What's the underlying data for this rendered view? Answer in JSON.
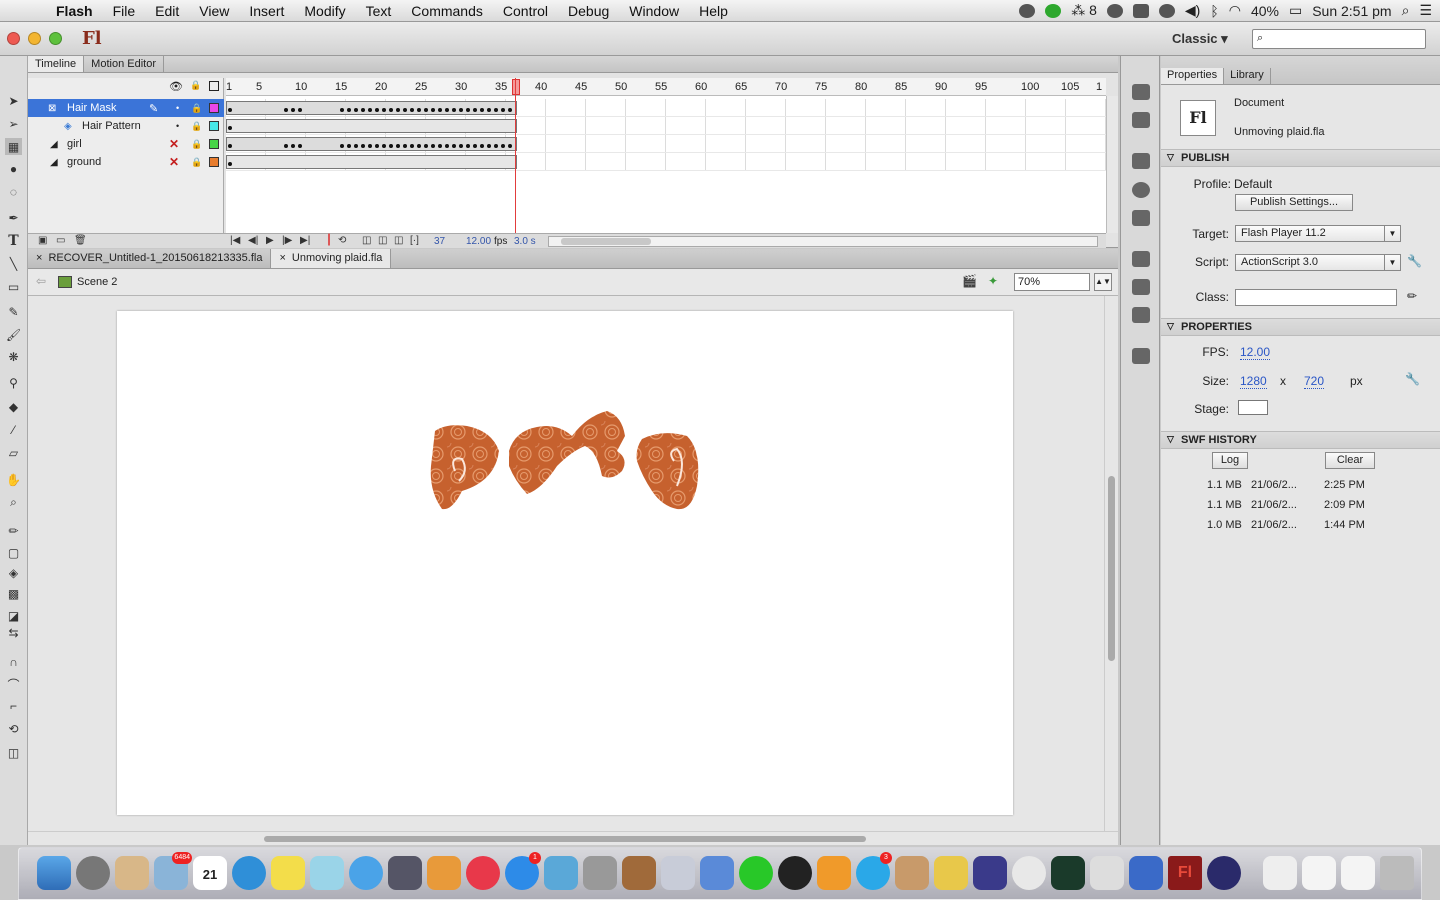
{
  "menubar": {
    "apple": "",
    "items": [
      "Flash",
      "File",
      "Edit",
      "View",
      "Insert",
      "Modify",
      "Text",
      "Commands",
      "Control",
      "Debug",
      "Window",
      "Help"
    ],
    "status": {
      "adobe_count": "8",
      "battery": "40%",
      "clock": "Sun 2:51 pm"
    }
  },
  "window": {
    "logo": "Fl",
    "workspace": "Classic ▾"
  },
  "timeline": {
    "tabs": [
      "Timeline",
      "Motion Editor"
    ],
    "ruler": [
      "1",
      "5",
      "10",
      "15",
      "20",
      "25",
      "30",
      "35",
      "40",
      "45",
      "50",
      "55",
      "60",
      "65",
      "70",
      "75",
      "80",
      "85",
      "90",
      "95",
      "100",
      "105",
      "1"
    ],
    "layers": [
      {
        "name": "Hair Mask",
        "color": "#e847e8",
        "selected": true,
        "type": "mask"
      },
      {
        "name": "Hair Pattern",
        "color": "#47e8e8",
        "selected": false,
        "type": "masked"
      },
      {
        "name": "girl",
        "color": "#47d447",
        "selected": false,
        "type": "normal"
      },
      {
        "name": "ground",
        "color": "#e87d2e",
        "selected": false,
        "type": "normal"
      }
    ],
    "status": {
      "frame": "37",
      "fps": "12.00",
      "fps_unit": "fps",
      "time": "3.0 s"
    }
  },
  "documents": {
    "tabs": [
      {
        "label": "RECOVER_Untitled-1_20150618213335.fla",
        "active": false
      },
      {
        "label": "Unmoving plaid.fla",
        "active": true
      }
    ]
  },
  "scene": {
    "name": "Scene 2",
    "zoom": "70%"
  },
  "properties": {
    "tabs": [
      "Properties",
      "Library"
    ],
    "doc_type": "Document",
    "doc_name": "Unmoving plaid.fla",
    "sections": {
      "publish": "PUBLISH",
      "properties": "PROPERTIES",
      "history": "SWF HISTORY"
    },
    "publish": {
      "profile_label": "Profile:",
      "profile_value": "Default",
      "settings_button": "Publish Settings...",
      "target_label": "Target:",
      "target_value": "Flash Player 11.2",
      "script_label": "Script:",
      "script_value": "ActionScript 3.0",
      "class_label": "Class:"
    },
    "props": {
      "fps_label": "FPS:",
      "fps_value": "12.00",
      "size_label": "Size:",
      "width": "1280",
      "x": "x",
      "height": "720",
      "unit": "px",
      "stage_label": "Stage:"
    },
    "history": {
      "log_button": "Log",
      "clear_button": "Clear",
      "rows": [
        {
          "size": "1.1 MB",
          "date": "21/06/2...",
          "time": "2:25 PM"
        },
        {
          "size": "1.1 MB",
          "date": "21/06/2...",
          "time": "2:09 PM"
        },
        {
          "size": "1.0 MB",
          "date": "21/06/2...",
          "time": "1:44 PM"
        }
      ]
    }
  },
  "dock": {
    "mail_badge": "6484",
    "calendar_day": "21",
    "appstore_badge": "1",
    "skype_badge": "3",
    "flash_label": "Fl"
  }
}
